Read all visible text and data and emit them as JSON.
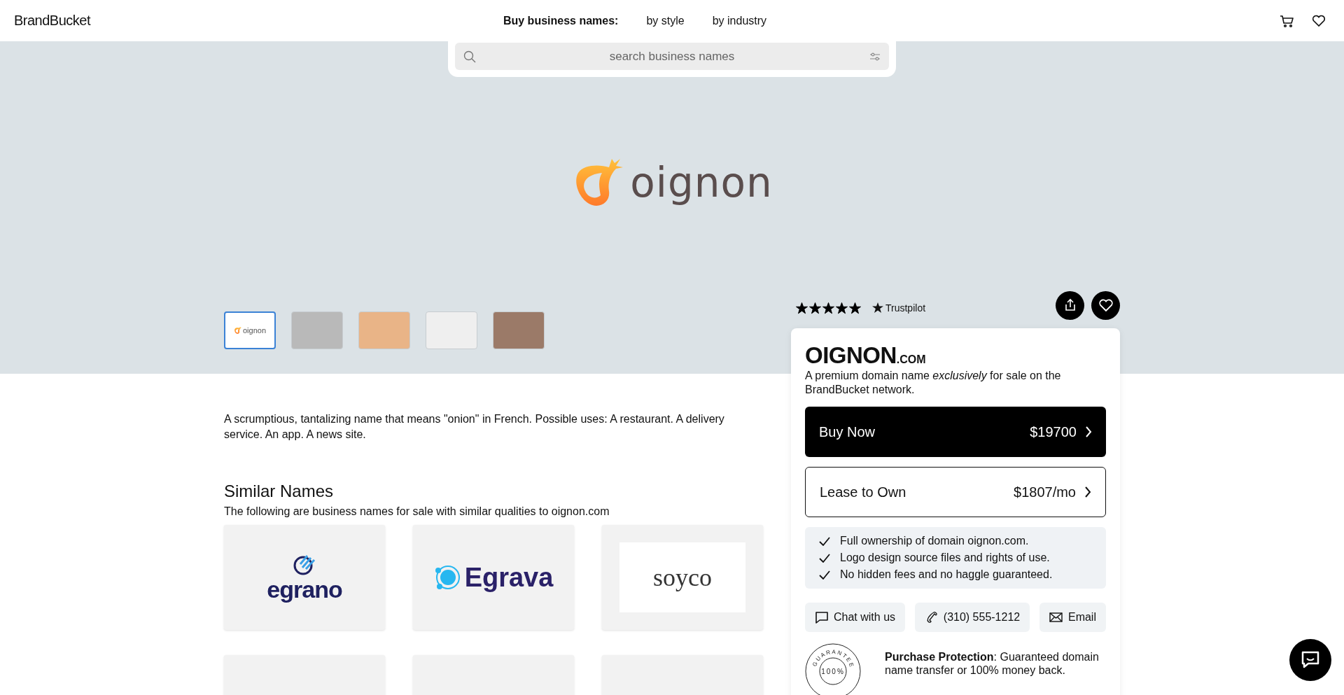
{
  "header": {
    "logo": "BrandBucket",
    "nav_label": "Buy business names:",
    "nav_links": [
      "by style",
      "by industry"
    ]
  },
  "search": {
    "placeholder": "search business names"
  },
  "hero": {
    "logo_text": "oignon"
  },
  "thumbnails": [
    {
      "kind": "logo",
      "label": "oignon",
      "selected": true
    },
    {
      "kind": "photo",
      "selected": false
    },
    {
      "kind": "photo",
      "selected": false
    },
    {
      "kind": "photo",
      "selected": false
    },
    {
      "kind": "photo",
      "selected": false
    }
  ],
  "description": "A scrumptious, tantalizing name that means \"onion\" in French. Possible uses: A restaurant. A delivery service. An app. A news site.",
  "similar": {
    "title": "Similar Names",
    "subtitle": "The following are business names for sale with similar qualities to oignon.com",
    "items": [
      {
        "kind": "stacked",
        "name": "egrano"
      },
      {
        "kind": "inline",
        "name": "Egrava"
      },
      {
        "kind": "framed",
        "name": "soyco"
      },
      {
        "kind": "cropped"
      },
      {
        "kind": "cropped"
      },
      {
        "kind": "cropped"
      }
    ]
  },
  "rating": {
    "stars": 5,
    "label": "Trustpilot"
  },
  "offer": {
    "name": "OIGNON",
    "tld": ".COM",
    "tagline": "A premium domain name *exclusively* for sale on the BrandBucket network.",
    "buttons": [
      {
        "kind": "primary",
        "label": "Buy Now",
        "price": "$19700"
      },
      {
        "kind": "outline",
        "label": "Lease to Own",
        "price": "$1807/mo"
      }
    ],
    "features": [
      "Full ownership of domain oignon.com.",
      "Logo design source files and rights of use.",
      "No hidden fees and no haggle guaranteed."
    ],
    "contacts": [
      {
        "kind": "chat",
        "label": "Chat with us"
      },
      {
        "kind": "phone",
        "label": "(310) 555-1212"
      },
      {
        "kind": "email",
        "label": "Email"
      }
    ],
    "seal": {
      "arc": "GUARANTEE",
      "center": "100%"
    },
    "protection": "**Purchase Protection**: Guaranteed domain name transfer or 100% money back."
  }
}
